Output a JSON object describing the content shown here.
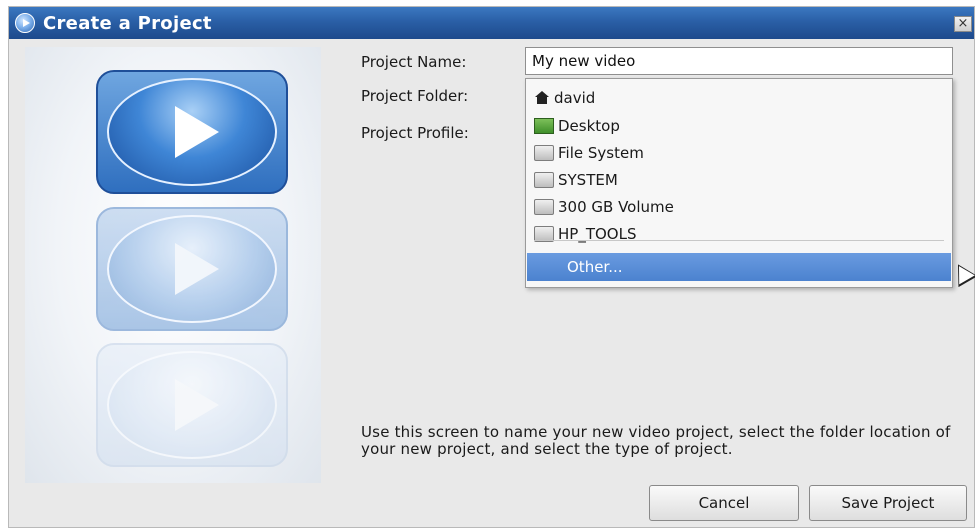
{
  "window": {
    "title": "Create a Project",
    "close_label": "×"
  },
  "form": {
    "name_label": "Project Name:",
    "name_value": "My new video",
    "folder_label": "Project Folder:",
    "profile_label": "Project Profile:"
  },
  "folder_dropdown": {
    "items": [
      {
        "label": "david",
        "icon": "home-icon"
      },
      {
        "label": "Desktop",
        "icon": "desktop-folder-icon"
      },
      {
        "label": "File System",
        "icon": "drive-icon"
      },
      {
        "label": "SYSTEM",
        "icon": "drive-icon"
      },
      {
        "label": "300 GB Volume",
        "icon": "drive-icon"
      },
      {
        "label": "HP_TOOLS",
        "icon": "drive-icon"
      }
    ],
    "other_label": "Other...",
    "highlight_color": "#4b82cf"
  },
  "help": {
    "text": "Use this screen to name your new video project, select the folder location of your new project, and select the type of project."
  },
  "buttons": {
    "cancel": "Cancel",
    "save": "Save Project"
  },
  "colors": {
    "titlebar": "#2a5fa6",
    "accent": "#3f86d6"
  }
}
